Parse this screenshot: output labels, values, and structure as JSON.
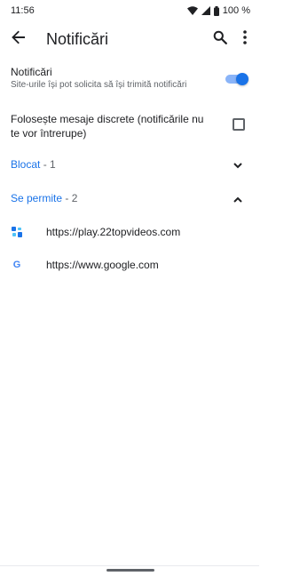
{
  "status_bar": {
    "time": "11:56",
    "battery": "100 %",
    "icons": [
      "wifi-icon",
      "signal-icon",
      "battery-icon"
    ]
  },
  "app_bar": {
    "title": "Notificări",
    "icons": [
      "back-arrow-icon",
      "search-icon",
      "more-vert-icon"
    ]
  },
  "notifications": {
    "label": "Notificări",
    "description": "Site-urile își pot solicita să își trimită notificări",
    "enabled": true
  },
  "quiet_messages": {
    "label": "Folosește mesaje discrete (notificările nu te vor întrerupe)",
    "checked": false
  },
  "sections": {
    "blocked": {
      "name": "Blocat",
      "count": " - 1",
      "expanded": false
    },
    "allowed": {
      "name": "Se permite",
      "count": " - 2",
      "expanded": true
    }
  },
  "sites": [
    {
      "url": "https://play.22topvideos.com",
      "icon": "site-favicon-icon"
    },
    {
      "url": "https://www.google.com",
      "icon": "google-g-icon"
    }
  ],
  "colors": {
    "accent": "#1a73e8",
    "toggle_track": "#8ab4f8",
    "text_primary": "#202124",
    "text_secondary": "#5f6368"
  }
}
